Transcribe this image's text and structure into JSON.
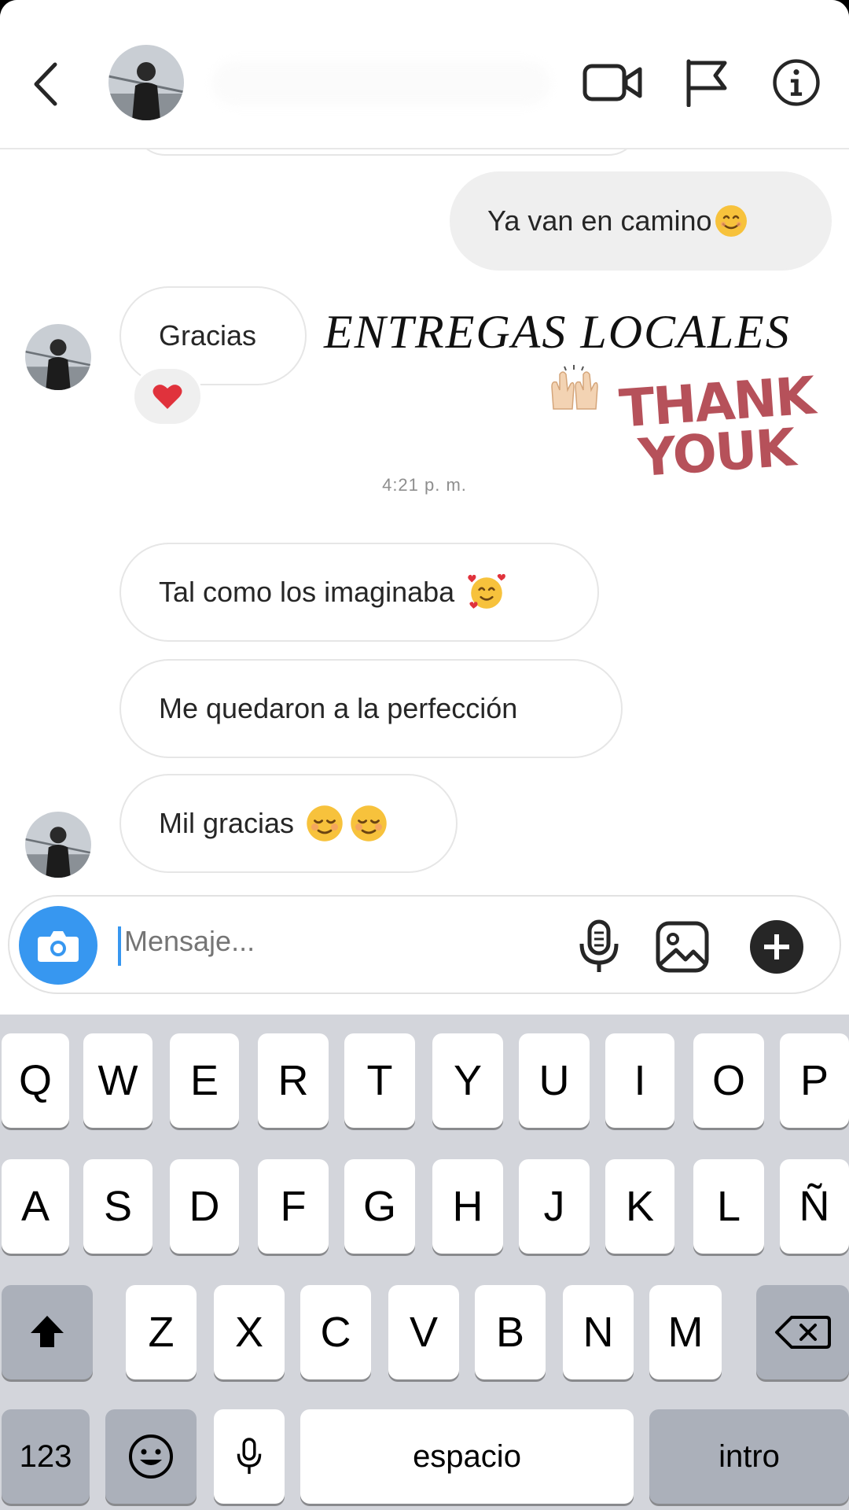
{
  "header": {
    "back_icon": "chevron-left-icon",
    "contact_avatar": "contact-avatar",
    "actions": [
      "video-call-icon",
      "report-flag-icon",
      "info-icon"
    ]
  },
  "messages": {
    "outgoing_1": "Ya van en camino",
    "incoming_1": "Gracias",
    "reaction": "heart-icon",
    "timestamp": "4:21 p. m.",
    "incoming_2": "Tal como los imaginaba",
    "incoming_3": "Me quedaron a la perfección",
    "incoming_4": "Mil gracias"
  },
  "sticker": {
    "title": "ENTREGAS LOCALES",
    "thank_line1": "THANK",
    "thank_line2": "YOUK"
  },
  "composer": {
    "placeholder": "Mensaje...",
    "icons": [
      "camera-icon",
      "microphone-icon",
      "gallery-icon",
      "plus-icon"
    ]
  },
  "keyboard": {
    "row1": [
      "Q",
      "W",
      "E",
      "R",
      "T",
      "Y",
      "U",
      "I",
      "O",
      "P"
    ],
    "row2": [
      "A",
      "S",
      "D",
      "F",
      "G",
      "H",
      "J",
      "K",
      "L",
      "Ñ"
    ],
    "row3": [
      "Z",
      "X",
      "C",
      "V",
      "B",
      "N",
      "M"
    ],
    "numbers_key": "123",
    "space_key": "espacio",
    "return_key": "intro"
  },
  "colors": {
    "accent": "#3797f0",
    "heart": "#e0323c",
    "thank_you": "#b6515a",
    "keyboard_bg": "#d3d5db"
  }
}
